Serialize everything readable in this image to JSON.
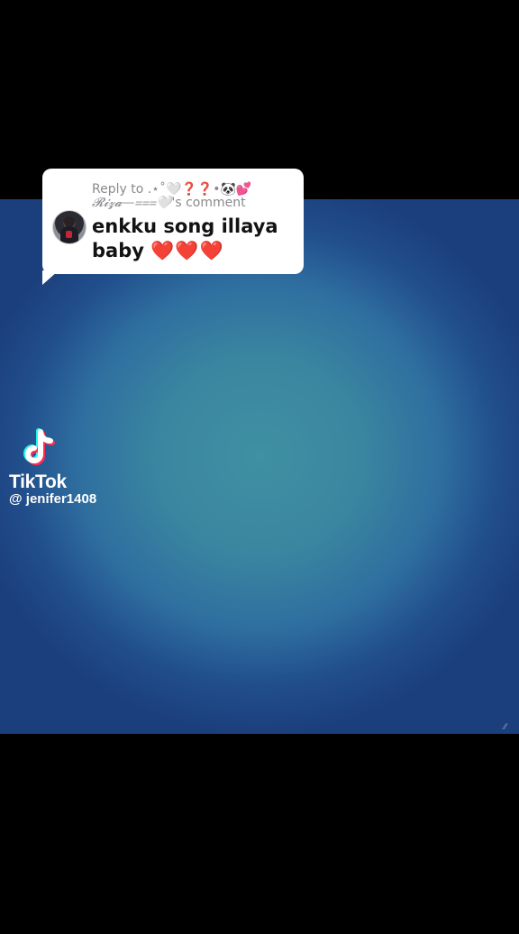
{
  "reply": {
    "prefix": "Reply to",
    "username": ".⋆˚🤍❓❓•🐼💕",
    "username_line2": "𝓡𝓲𝔃𝓪—⩶🤍",
    "suffix": "'s comment",
    "comment": "enkku song illaya baby",
    "hearts": "❤️❤️❤️"
  },
  "watermark": {
    "brand": "TikTok",
    "handle": "@ jenifer1408"
  },
  "colors": {
    "background": "#000000",
    "video_center": "#3f90a3",
    "video_edge": "#1b3f7c",
    "tiktok_cyan": "#25f4ee",
    "tiktok_red": "#fe2c55"
  }
}
